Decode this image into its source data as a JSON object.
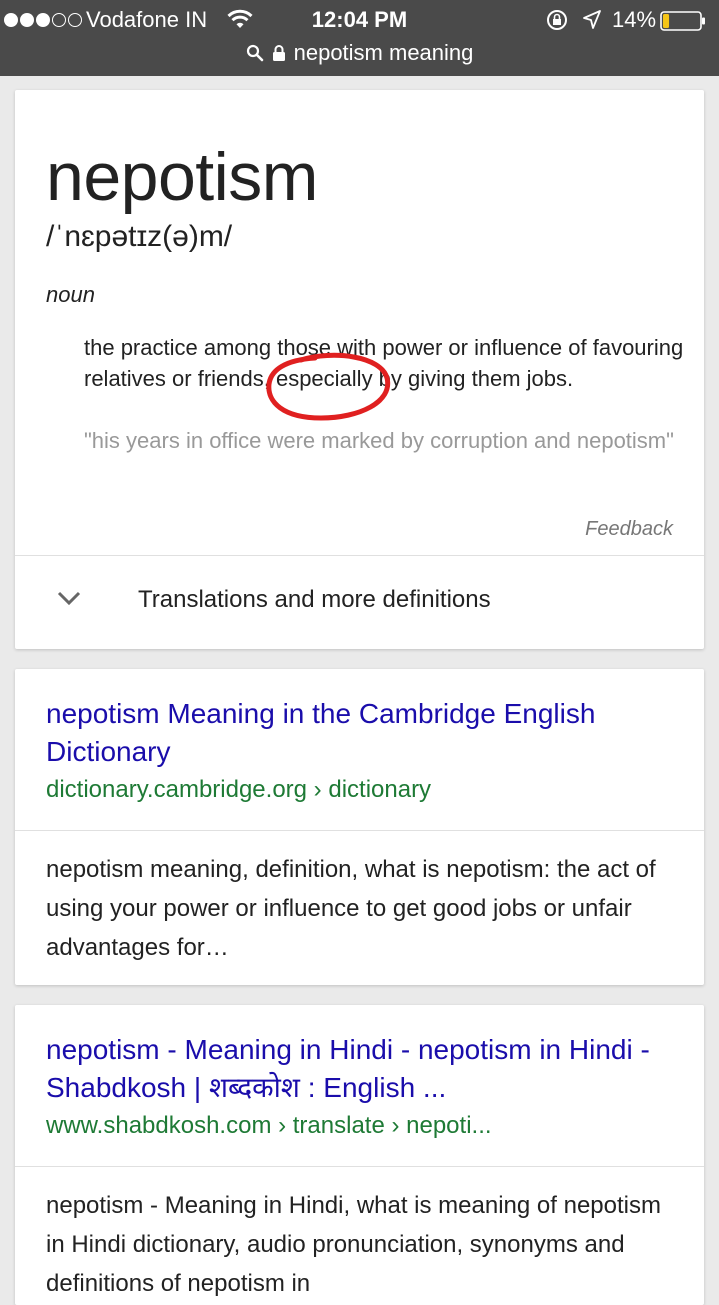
{
  "status_bar": {
    "carrier": "Vodafone IN",
    "time": "12:04 PM",
    "battery": "14%",
    "battery_level": 0.14,
    "signal_bars_filled": 3,
    "signal_bars_total": 5
  },
  "url_bar": {
    "query": "nepotism meaning",
    "icons": [
      "search-icon",
      "lock-icon"
    ]
  },
  "dictionary": {
    "word": "nepotism",
    "phonetic": "/ˈnɛpətɪz(ə)m/",
    "part_of_speech": "noun",
    "definition": "the practice among those with power or influence of favouring relatives or friends, especially by giving them jobs.",
    "example": "\"his years in office were marked by corruption and nepotism\"",
    "feedback": "Feedback",
    "more_label": "Translations and more definitions",
    "annotation_color": "#e02020"
  },
  "results": [
    {
      "title": "nepotism Meaning in the Cambridge English Dictionary",
      "cite": "dictionary.cambridge.org › dictionary",
      "snippet": "nepotism meaning, definition, what is nepotism: the act of using your power or influence to get good jobs or unfair advantages for…"
    },
    {
      "title": "nepotism - Meaning in Hindi - nepotism in Hindi - Shabdkosh | शब्दकोश : English ...",
      "cite": "www.shabdkosh.com › translate › nepoti...",
      "snippet": "nepotism - Meaning in Hindi, what is meaning of nepotism in Hindi dictionary, audio pronunciation, synonyms and definitions of nepotism in"
    }
  ],
  "colors": {
    "link": "#1a0dab",
    "cite": "#1e7a35",
    "topbar": "#4a4a4a",
    "battery_low": "#f5c518"
  }
}
